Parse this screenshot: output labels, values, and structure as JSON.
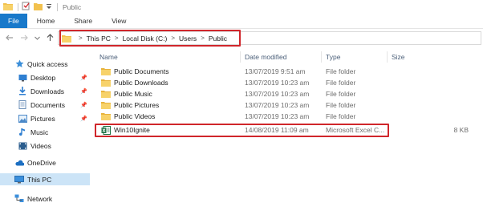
{
  "window": {
    "title": "Public"
  },
  "ribbon": {
    "tabs": [
      "File",
      "Home",
      "Share",
      "View"
    ]
  },
  "address": {
    "crumbs": [
      "This PC",
      "Local Disk (C:)",
      "Users",
      "Public"
    ]
  },
  "sidebar": {
    "items": [
      {
        "label": "Quick access",
        "icon": "star-icon"
      },
      {
        "label": "Desktop",
        "icon": "desktop-icon",
        "pinned": true
      },
      {
        "label": "Downloads",
        "icon": "download-icon",
        "pinned": true
      },
      {
        "label": "Documents",
        "icon": "document-icon",
        "pinned": true
      },
      {
        "label": "Pictures",
        "icon": "pictures-icon",
        "pinned": true
      },
      {
        "label": "Music",
        "icon": "music-icon"
      },
      {
        "label": "Videos",
        "icon": "videos-icon"
      },
      {
        "label": "OneDrive",
        "icon": "cloud-icon"
      },
      {
        "label": "This PC",
        "icon": "computer-icon",
        "selected": true
      },
      {
        "label": "Network",
        "icon": "network-icon"
      }
    ]
  },
  "columns": [
    "Name",
    "Date modified",
    "Type",
    "Size"
  ],
  "files": [
    {
      "name": "Public Documents",
      "date": "13/07/2019 9:51 am",
      "type": "File folder",
      "size": "",
      "icon": "folder-icon"
    },
    {
      "name": "Public Downloads",
      "date": "13/07/2019 10:23 am",
      "type": "File folder",
      "size": "",
      "icon": "folder-icon"
    },
    {
      "name": "Public Music",
      "date": "13/07/2019 10:23 am",
      "type": "File folder",
      "size": "",
      "icon": "folder-icon"
    },
    {
      "name": "Public Pictures",
      "date": "13/07/2019 10:23 am",
      "type": "File folder",
      "size": "",
      "icon": "folder-icon"
    },
    {
      "name": "Public Videos",
      "date": "13/07/2019 10:23 am",
      "type": "File folder",
      "size": "",
      "icon": "folder-icon"
    },
    {
      "name": "Win10Ignite",
      "date": "14/08/2019 11:09 am",
      "type": "Microsoft Excel C...",
      "size": "8 KB",
      "icon": "excel-csv-icon"
    }
  ],
  "colors": {
    "accent": "#1979ca",
    "highlight": "#d0262b",
    "selected_bg": "#cce4f7",
    "folder": "#f2c14e"
  }
}
